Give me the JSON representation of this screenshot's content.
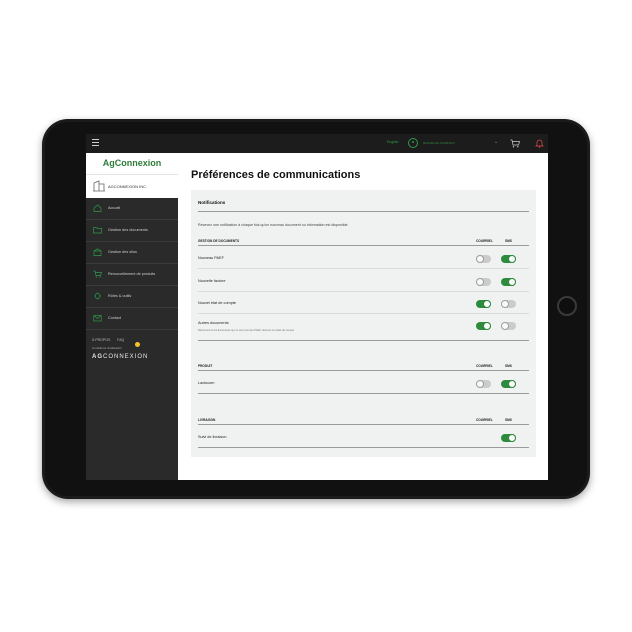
{
  "topbar": {
    "language": "English",
    "user": "NICHOLAS CONTACT",
    "icons": [
      "hamburger-icon",
      "user-avatar-icon",
      "chevron-down-icon",
      "cart-icon",
      "bell-icon"
    ]
  },
  "sidebar": {
    "logo": "AgConnexion",
    "company": "AGCONNEXION INC.",
    "items": [
      {
        "label": "Accueil",
        "icon": "home-icon"
      },
      {
        "label": "Gestion des documents",
        "icon": "folder-icon"
      },
      {
        "label": "Gestion des silos",
        "icon": "silo-icon"
      },
      {
        "label": "Renouvellement de produits",
        "icon": "cart-icon"
      },
      {
        "label": "Rôles & outils",
        "icon": "tools-icon"
      },
      {
        "label": "Contact",
        "icon": "contact-icon"
      }
    ],
    "links": [
      "À PROPOS",
      "FAQ"
    ],
    "conditions": "Conditions d'utilisation",
    "brand_bold": "AG",
    "brand_light": "CONNEXION"
  },
  "main": {
    "title": "Préférences de communications",
    "card": {
      "heading": "Notifications",
      "description": "Recevez une notification à chaque fois qu'un nouveau document ou information est disponible.",
      "col_email": "COURRIEL",
      "col_sms": "SMS",
      "sections": [
        {
          "title": "GESTION DE DOCUMENTS",
          "rows": [
            {
              "label": "Nouveau PAEF",
              "email": false,
              "sms": true
            },
            {
              "label": "Nouvelle facture",
              "email": false,
              "sms": true
            },
            {
              "label": "Nouvel état de compte",
              "email": true,
              "sms": false
            },
            {
              "label": "Autres documents",
              "sub": "Retrouvez ici les documents qui ne sont pas des PAEF, factures ou états de compte",
              "email": true,
              "sms": false
            }
          ]
        },
        {
          "title": "PRODUIT",
          "rows": [
            {
              "label": "Lactocom",
              "email": false,
              "sms": true
            }
          ]
        },
        {
          "title": "LIVRAISON",
          "rows": [
            {
              "label": "Suivi de livraison",
              "email": null,
              "sms": true
            }
          ]
        }
      ]
    }
  },
  "colors": {
    "accent": "#2e8b3e",
    "sidebar_bg": "#2a2a2a",
    "card_bg": "#f0f1f1",
    "toggle_off": "#cbcbcb"
  }
}
